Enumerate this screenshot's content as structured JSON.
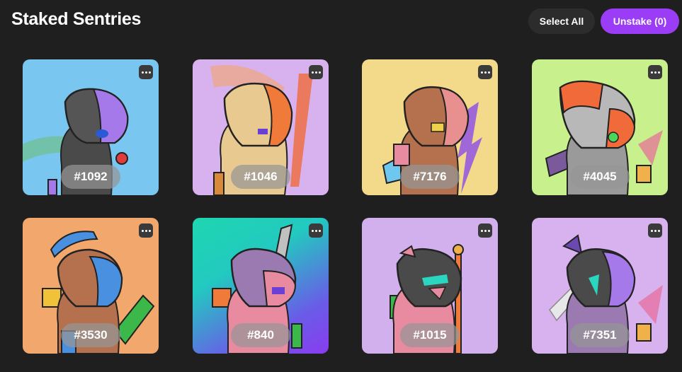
{
  "header": {
    "title": "Staked Sentries",
    "select_all_label": "Select All",
    "unstake_label": "Unstake (0)"
  },
  "accent_color": "#9b3cf6",
  "cards": [
    {
      "id": "#1092",
      "bg": "#79c6f0",
      "menu_icon": "more-horizontal-icon"
    },
    {
      "id": "#1046",
      "bg": "#d7b2ee",
      "menu_icon": "more-horizontal-icon"
    },
    {
      "id": "#7176",
      "bg": "#f3d98a",
      "menu_icon": "more-horizontal-icon"
    },
    {
      "id": "#4045",
      "bg": "#c8f08c",
      "menu_icon": "more-horizontal-icon"
    },
    {
      "id": "#3530",
      "bg": "#f2a86c",
      "menu_icon": "more-horizontal-icon"
    },
    {
      "id": "#840",
      "bg": "gradient-teal-purple",
      "menu_icon": "more-horizontal-icon"
    },
    {
      "id": "#1015",
      "bg": "#d2b0ee",
      "menu_icon": "more-horizontal-icon"
    },
    {
      "id": "#7351",
      "bg": "#d7b2ee",
      "menu_icon": "more-horizontal-icon"
    }
  ]
}
